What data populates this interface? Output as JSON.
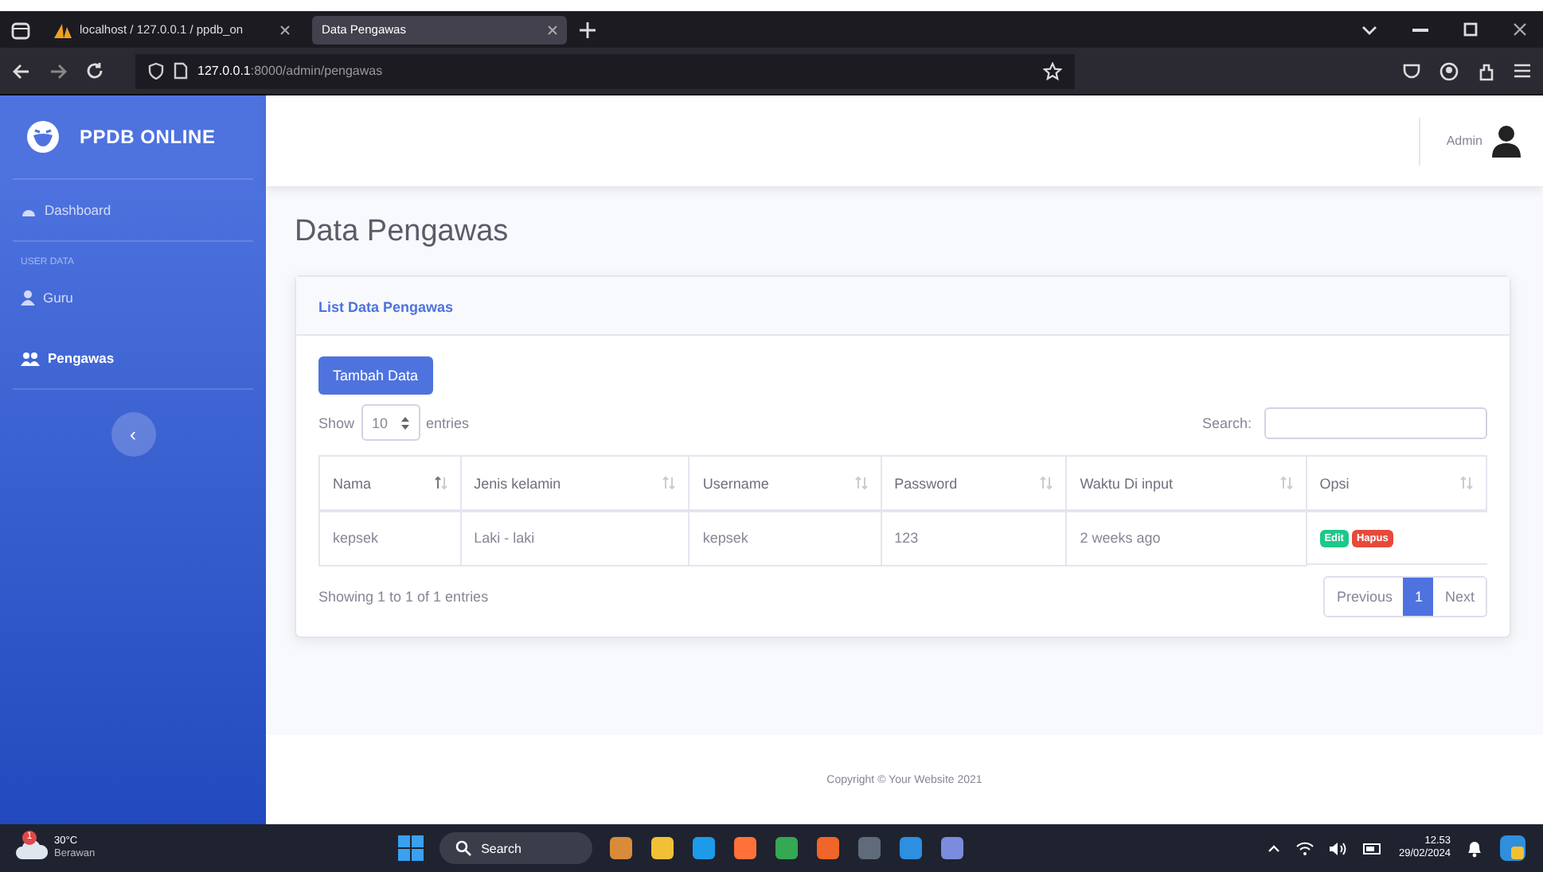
{
  "browser": {
    "tabs": [
      {
        "label": "localhost / 127.0.0.1 / ppdb_on",
        "selected": false
      },
      {
        "label": "Data Pengawas",
        "selected": true
      }
    ],
    "url_host": "127.0.0.1",
    "url_path": ":8000/admin/pengawas"
  },
  "sidebar": {
    "brand": "PPDB ONLINE",
    "items": [
      {
        "kind": "dashboard",
        "label": "Dashboard",
        "selected": false
      },
      {
        "kind": "heading",
        "label": "USER DATA"
      },
      {
        "kind": "user",
        "label": "Guru",
        "selected": false
      },
      {
        "kind": "users",
        "label": "Pengawas",
        "selected": true
      }
    ],
    "toggle": "‹"
  },
  "topbar": {
    "user": "Admin"
  },
  "page_title": "Data Pengawas",
  "card": {
    "title": "List Data Pengawas",
    "add_button": "Tambah Data",
    "show_label": "Show",
    "page_size": "10",
    "entries_label": "entries",
    "search_label": "Search:",
    "columns": [
      {
        "label": "Nama",
        "sorted": true
      },
      {
        "label": "Jenis kelamin",
        "sorted": false
      },
      {
        "label": "Username",
        "sorted": false
      },
      {
        "label": "Password",
        "sorted": false
      },
      {
        "label": "Waktu Di input",
        "sorted": false
      },
      {
        "label": "Opsi",
        "sorted": false
      }
    ],
    "rows": [
      {
        "cells": [
          "kepsek",
          "Laki - laki",
          "kepsek",
          "123",
          "2 weeks ago"
        ],
        "actions": [
          {
            "kind": "edit",
            "label": "Edit"
          },
          {
            "kind": "delete",
            "label": "Hapus"
          }
        ]
      }
    ],
    "info": "Showing 1 to 1 of 1 entries",
    "pagination": [
      {
        "label": "Previous",
        "selected": false
      },
      {
        "label": "1",
        "selected": true
      },
      {
        "label": "Next",
        "selected": false
      }
    ]
  },
  "footer": "Copyright © Your Website 2021",
  "taskbar": {
    "weather_badge": "1",
    "temperature": "30°C",
    "weather": "Berawan",
    "search": "Search",
    "time": "12.53",
    "date": "29/02/2024"
  }
}
